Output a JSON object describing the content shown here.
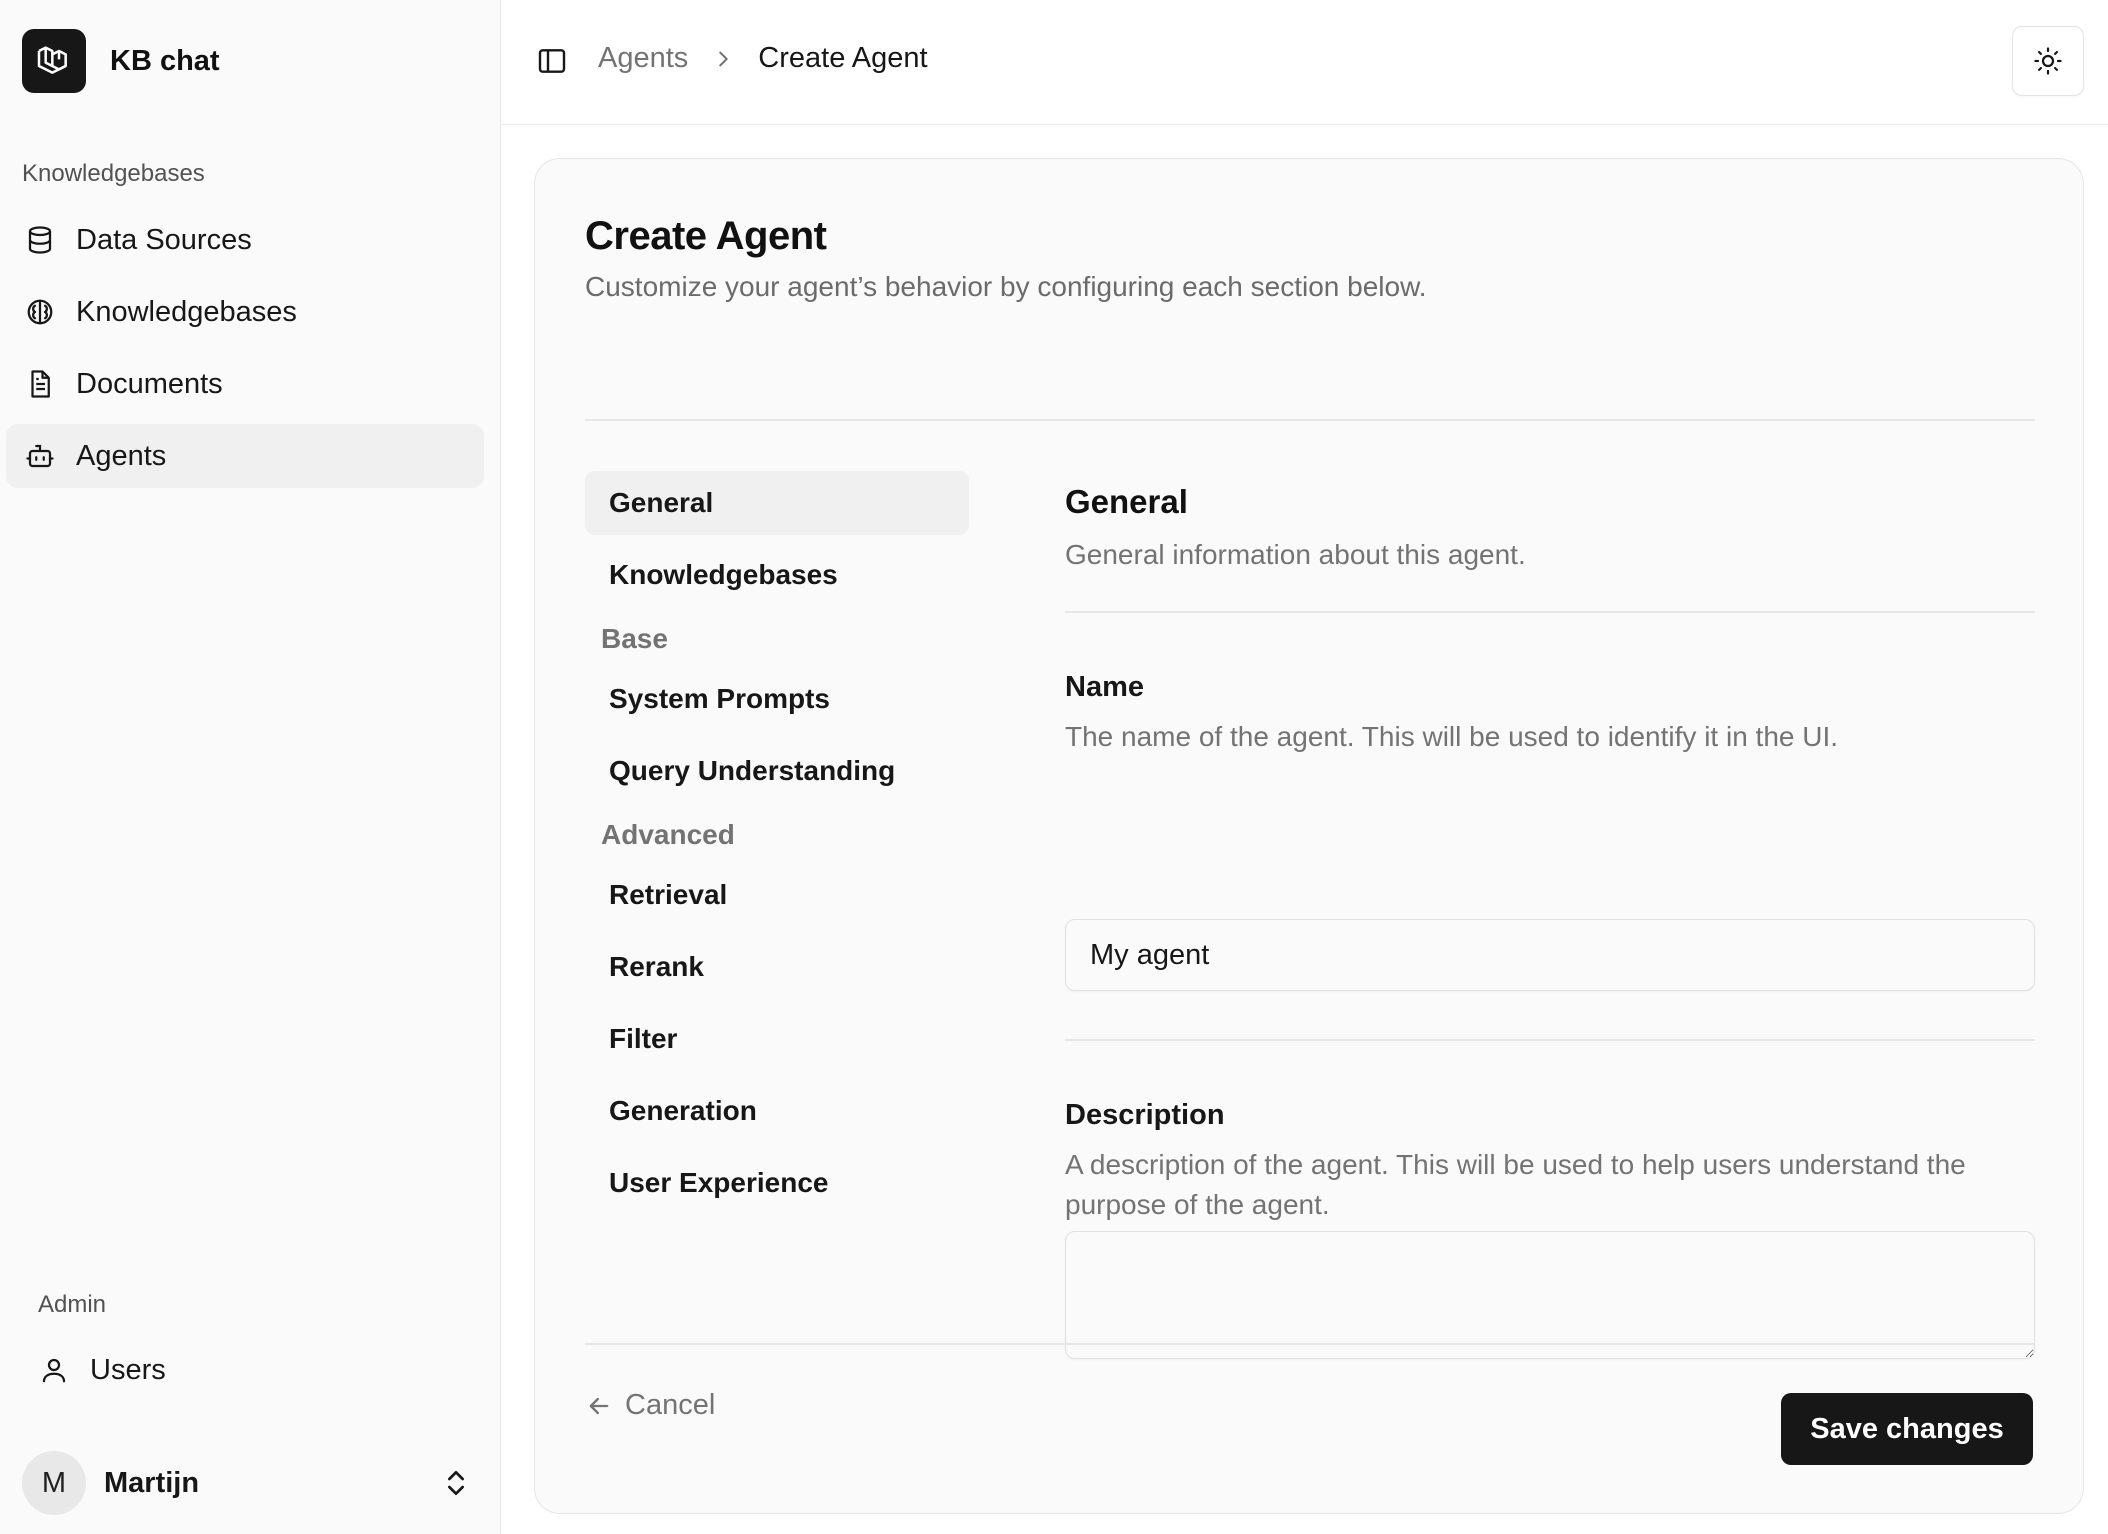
{
  "app": {
    "name": "KB chat"
  },
  "sidebar": {
    "section_label": "Knowledgebases",
    "items": [
      {
        "label": "Data Sources",
        "icon": "database-icon",
        "active": false
      },
      {
        "label": "Knowledgebases",
        "icon": "brain-icon",
        "active": false
      },
      {
        "label": "Documents",
        "icon": "document-icon",
        "active": false
      },
      {
        "label": "Agents",
        "icon": "bot-icon",
        "active": true
      }
    ],
    "admin_label": "Admin",
    "admin_items": [
      {
        "label": "Users",
        "icon": "user-icon"
      }
    ],
    "user": {
      "initial": "M",
      "name": "Martijn"
    }
  },
  "header": {
    "breadcrumb": {
      "parent": "Agents",
      "current": "Create Agent"
    }
  },
  "page": {
    "title": "Create Agent",
    "subtitle": "Customize your agent’s behavior by configuring each section below."
  },
  "sections": {
    "top": [
      {
        "label": "General",
        "active": true
      },
      {
        "label": "Knowledgebases",
        "active": false
      }
    ],
    "groups": [
      {
        "label": "Base",
        "items": [
          "System Prompts",
          "Query Understanding"
        ]
      },
      {
        "label": "Advanced",
        "items": [
          "Retrieval",
          "Rerank",
          "Filter",
          "Generation",
          "User Experience"
        ]
      }
    ]
  },
  "form": {
    "title": "General",
    "subtitle": "General information about this agent.",
    "name": {
      "label": "Name",
      "help": "The name of the agent. This will be used to identify it in the UI.",
      "value": "My agent"
    },
    "description": {
      "label": "Description",
      "help": "A description of the agent. This will be used to help users understand the purpose of the agent.",
      "value": ""
    }
  },
  "actions": {
    "cancel": "Cancel",
    "save": "Save changes"
  },
  "colors": {
    "primary": "#171717",
    "muted_text": "#737373",
    "background": "#fafafa"
  }
}
